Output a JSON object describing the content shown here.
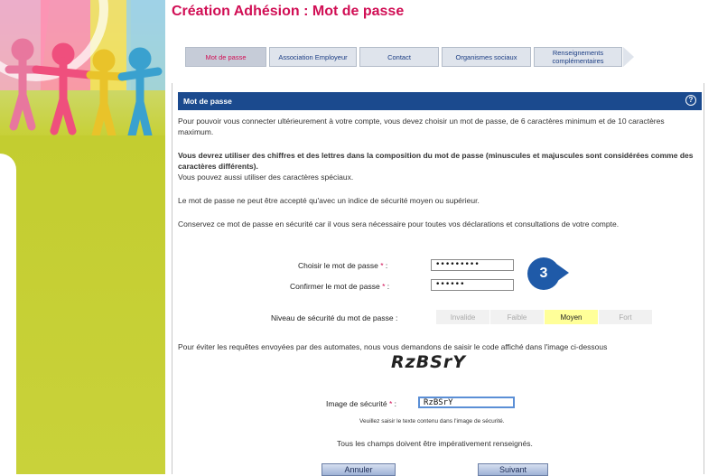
{
  "page": {
    "title": "Création Adhésion : Mot de passe"
  },
  "steps": [
    {
      "label": "Mot de passe"
    },
    {
      "label": "Association Employeur"
    },
    {
      "label": "Contact"
    },
    {
      "label": "Organismes sociaux"
    },
    {
      "label": "Renseignements complémentaires"
    }
  ],
  "section": {
    "title": "Mot de passe",
    "help_icon": "question-circle-icon"
  },
  "text": {
    "p1": "Pour pouvoir vous connecter ultérieurement à votre compte, vous devez choisir un mot de passe, de 6 caractères minimum et de 10 caractères maximum.",
    "p2_bold": "Vous devrez utiliser des chiffres et des lettres dans la composition du mot de passe (minuscules et majuscules sont considérées comme des caractères différents).",
    "p2": "Vous pouvez aussi utiliser des caractères spéciaux.",
    "p3": "Le mot de passe ne peut être accepté qu'avec un indice de sécurité moyen ou supérieur.",
    "p4": "Conservez ce mot de passe en sécurité car il vous sera nécessaire pour toutes vos déclarations et consultations de votre compte.",
    "p5": "Pour éviter les requêtes envoyées par des automates, nous vous demandons de saisir le code affiché dans l'image ci-dessous"
  },
  "form": {
    "password_label": "Choisir le mot de passe",
    "password_value": "•••••••••",
    "confirm_label": "Confirmer le mot de passe",
    "confirm_value": "••••••",
    "required_mark": "*",
    "colon": ":",
    "strength_label": "Niveau de sécurité du mot de passe :",
    "strength_levels": [
      "Invalide",
      "Faible",
      "Moyen",
      "Fort"
    ],
    "strength_selected": "Moyen",
    "captcha_text": "RzBSrY",
    "captcha_label": "Image de sécurité",
    "captcha_value": "RzBSrY",
    "captcha_hint": "Veuillez saisir le texte contenu dans l'image de sécurité.",
    "all_required": "Tous les champs doivent être impérativement renseignés."
  },
  "badge": {
    "number": "3",
    "color": "#1f5aa8"
  },
  "buttons": {
    "cancel": "Annuler",
    "next": "Suivant"
  },
  "colors": {
    "title": "#d10f55",
    "header": "#1b4a8e",
    "left_panel": "#c6cf2e",
    "strength_active": "#ffff99"
  }
}
